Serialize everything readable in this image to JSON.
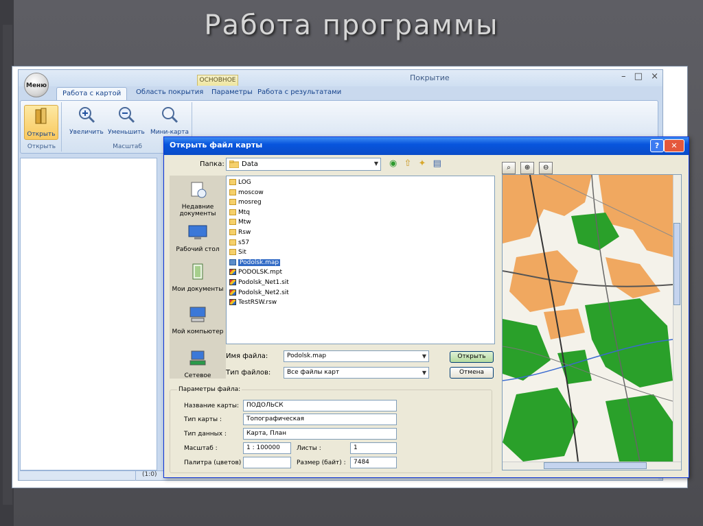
{
  "slide": {
    "title": "Работа программы"
  },
  "app": {
    "title": "Покрытие",
    "menu_button": "Меню",
    "win_controls": {
      "minimize": "–",
      "restore": "□",
      "close": "×"
    },
    "contextual_tab_header": "ОСНОВНОЕ",
    "tabs": [
      "Работа с картой",
      "Область покрытия",
      "Параметры",
      "Работа с результатами"
    ],
    "groups": {
      "open": {
        "label": "Открыть",
        "button": "Открыть"
      },
      "scale": {
        "label": "Масштаб",
        "buttons": [
          "Увеличить",
          "Уменьшить",
          "Мини-карта"
        ]
      }
    },
    "status": {
      "scale": "(1:0)"
    }
  },
  "dialog": {
    "title": "Открыть файл карты",
    "help": "?",
    "close": "✕",
    "look_in_label": "Папка:",
    "look_in_value": "Data",
    "places": [
      "Недавние документы",
      "Рабочий стол",
      "Мои документы",
      "Мой компьютер",
      "Сетевое"
    ],
    "files": [
      {
        "name": "LOG",
        "kind": "folder"
      },
      {
        "name": "moscow",
        "kind": "folder"
      },
      {
        "name": "mosreg",
        "kind": "folder"
      },
      {
        "name": "Mtq",
        "kind": "folder"
      },
      {
        "name": "Mtw",
        "kind": "folder"
      },
      {
        "name": "Rsw",
        "kind": "folder"
      },
      {
        "name": "s57",
        "kind": "folder"
      },
      {
        "name": "Sit",
        "kind": "folder"
      },
      {
        "name": "Podolsk.map",
        "kind": "map",
        "selected": true
      },
      {
        "name": "PODOLSK.mpt",
        "kind": "multi"
      },
      {
        "name": "Podolsk_Net1.sit",
        "kind": "multi"
      },
      {
        "name": "Podolsk_Net2.sit",
        "kind": "multi"
      },
      {
        "name": "TestRSW.rsw",
        "kind": "multi"
      }
    ],
    "filename_label": "Имя файла:",
    "filename_value": "Podolsk.map",
    "filetype_label": "Тип файлов:",
    "filetype_value": "Все файлы карт",
    "open_button": "Открыть",
    "cancel_button": "Отмена",
    "params": {
      "legend": "Параметры файла:",
      "map_name_label": "Название карты:",
      "map_name_value": "ПОДОЛЬСК",
      "map_type_label": "Тип карты :",
      "map_type_value": "Топографическая",
      "data_type_label": "Тип данных :",
      "data_type_value": "Карта, План",
      "scale_label": "Масштаб :",
      "scale_value": "1 : 100000",
      "sheets_label": "Листы :",
      "sheets_value": "1",
      "palette_label": "Палитра (цветов) :",
      "palette_value": "",
      "size_label": "Размер (байт) :",
      "size_value": "7484"
    }
  }
}
